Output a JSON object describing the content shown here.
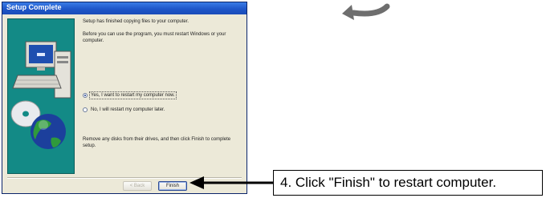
{
  "dialog": {
    "title": "Setup Complete",
    "message1": "Setup has finished copying files to your computer.",
    "message2": "Before you can use the program, you must restart Windows or your computer.",
    "options": [
      {
        "label": "Yes, I want to restart my computer now.",
        "selected": true
      },
      {
        "label": "No, I will restart my computer later.",
        "selected": false
      }
    ],
    "message3": "Remove any disks from their drives, and then click Finish to complete setup.",
    "back_label": "< Back",
    "finish_label": "Finish"
  },
  "callout": {
    "text": "4. Click \"Finish\" to restart computer."
  },
  "icons": {
    "decorative_arrow": "curved-arrow-icon",
    "pointer_arrow": "arrow-left-icon",
    "art": "computer-globe-illustration"
  }
}
